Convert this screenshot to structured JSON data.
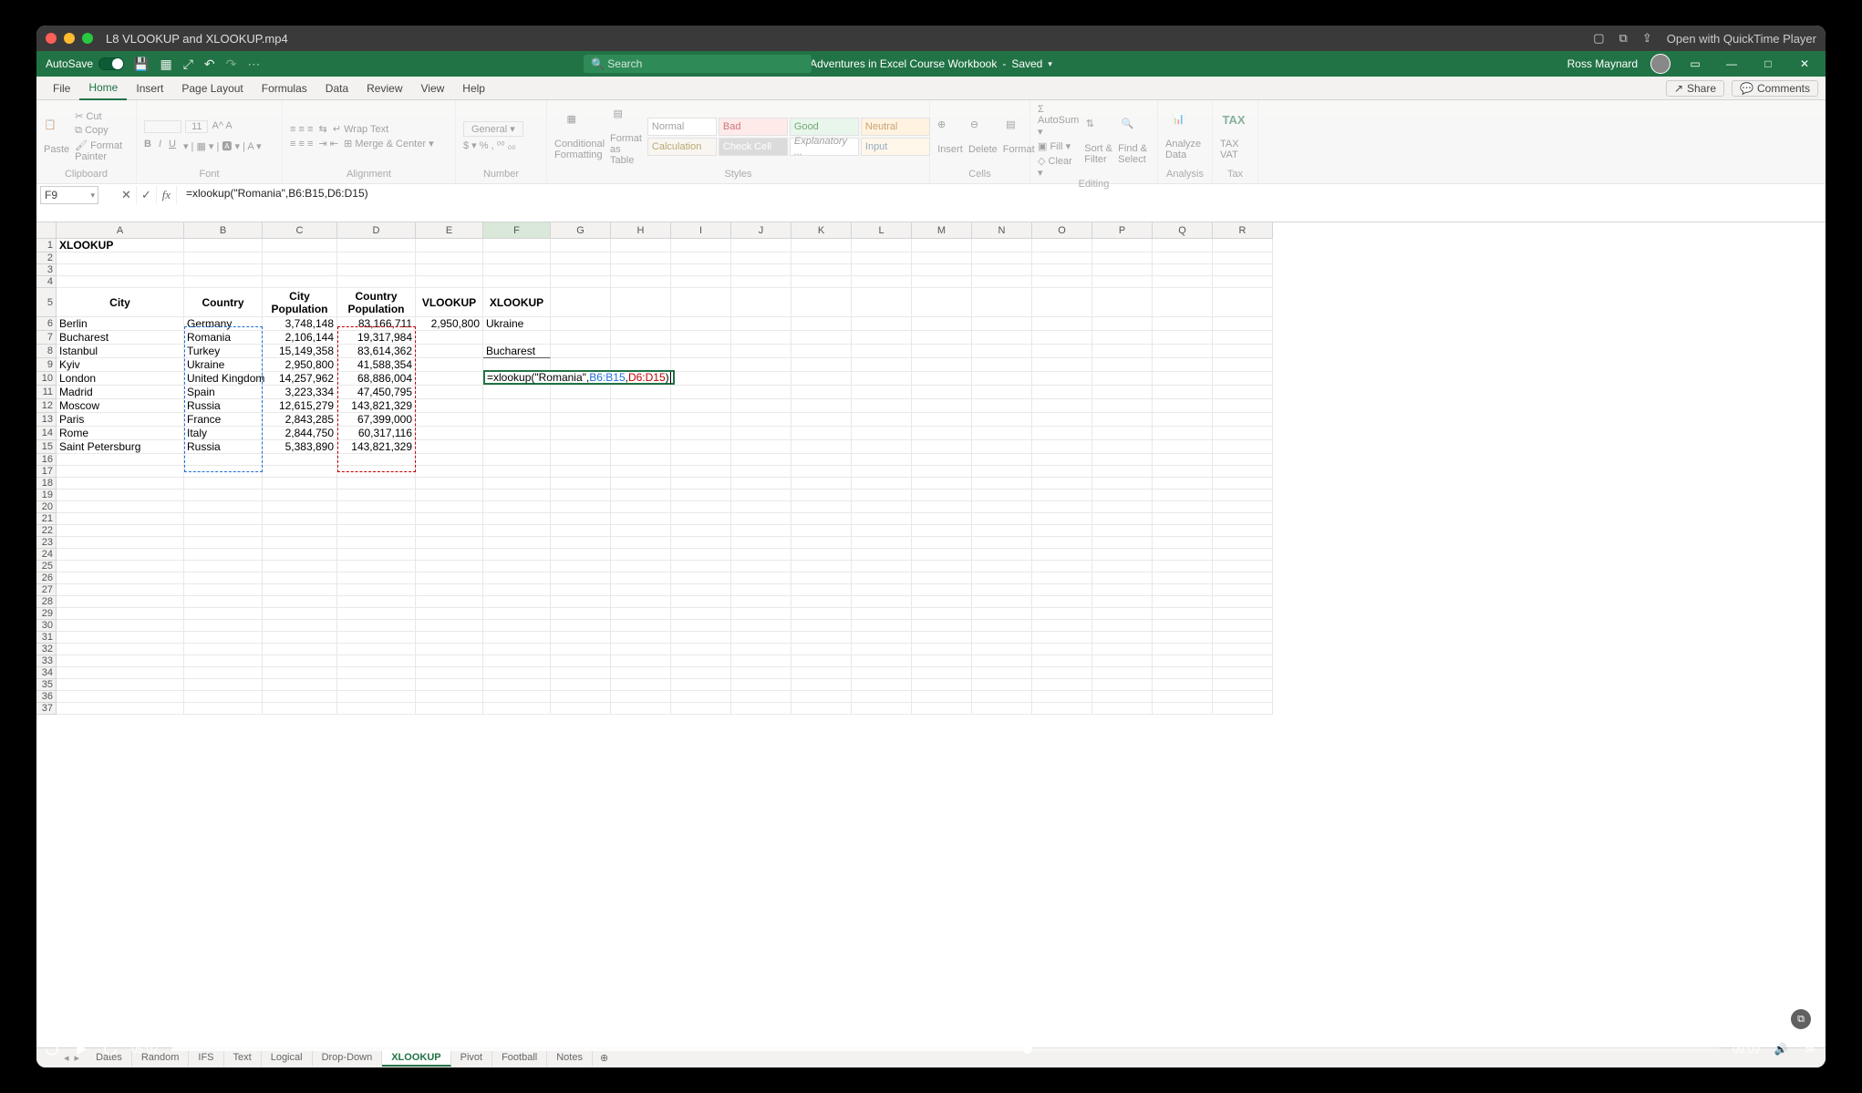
{
  "mac_titlebar": {
    "filename": "L8 VLOOKUP and XLOOKUP.mp4",
    "open_with": "Open with QuickTime Player"
  },
  "excel_titlebar": {
    "autosave_label": "AutoSave",
    "doc_title": "Adventures in Excel Course Workbook",
    "saved_label": "Saved",
    "search_placeholder": "Search",
    "user_name": "Ross Maynard"
  },
  "ribbon_tabs": [
    "File",
    "Home",
    "Insert",
    "Page Layout",
    "Formulas",
    "Data",
    "Review",
    "View",
    "Help"
  ],
  "ribbon_right": {
    "share": "Share",
    "comments": "Comments"
  },
  "ribbon_groups": {
    "clipboard": {
      "label": "Clipboard",
      "paste": "Paste",
      "cut": "Cut",
      "copy": "Copy",
      "format_painter": "Format Painter"
    },
    "font": {
      "label": "Font"
    },
    "alignment": {
      "label": "Alignment",
      "wrap": "Wrap Text",
      "merge": "Merge & Center"
    },
    "number": {
      "label": "Number",
      "general": "General"
    },
    "styles": {
      "label": "Styles",
      "cond": "Conditional Formatting",
      "fmt_table": "Format as Table",
      "normal": "Normal",
      "bad": "Bad",
      "good": "Good",
      "neutral": "Neutral",
      "calc": "Calculation",
      "check": "Check Cell",
      "expl": "Explanatory ...",
      "input": "Input"
    },
    "cells": {
      "label": "Cells",
      "insert": "Insert",
      "delete": "Delete",
      "format": "Format"
    },
    "editing": {
      "label": "Editing",
      "autosum": "AutoSum",
      "fill": "Fill",
      "clear": "Clear",
      "sort": "Sort & Filter",
      "find": "Find & Select"
    },
    "analysis": {
      "label": "Analysis",
      "analyze": "Analyze Data"
    },
    "tax": {
      "label": "Tax",
      "vat": "TAX VAT"
    }
  },
  "formula_bar": {
    "name_box": "F9",
    "formula": "=xlookup(\"Romania\",B6:B15,D6:D15)"
  },
  "columns": [
    "A",
    "B",
    "C",
    "D",
    "E",
    "F",
    "G",
    "H",
    "I",
    "J",
    "K",
    "L",
    "M",
    "N",
    "O",
    "P",
    "Q",
    "R"
  ],
  "row_count": 37,
  "sheet": {
    "title_cell": "XLOOKUP",
    "headers": {
      "city": "City",
      "country": "Country",
      "city_pop": "City Population",
      "country_pop": "Country Population",
      "vlookup": "VLOOKUP",
      "xlookup": "XLOOKUP"
    },
    "rows": [
      {
        "city": "Berlin",
        "country": "Germany",
        "city_pop": "3,748,148",
        "country_pop": "83,166,711"
      },
      {
        "city": "Bucharest",
        "country": "Romania",
        "city_pop": "2,106,144",
        "country_pop": "19,317,984"
      },
      {
        "city": "Istanbul",
        "country": "Turkey",
        "city_pop": "15,149,358",
        "country_pop": "83,614,362"
      },
      {
        "city": "Kyiv",
        "country": "Ukraine",
        "city_pop": "2,950,800",
        "country_pop": "41,588,354"
      },
      {
        "city": "London",
        "country": "United Kingdom",
        "city_pop": "14,257,962",
        "country_pop": "68,886,004"
      },
      {
        "city": "Madrid",
        "country": "Spain",
        "city_pop": "3,223,334",
        "country_pop": "47,450,795"
      },
      {
        "city": "Moscow",
        "country": "Russia",
        "city_pop": "12,615,279",
        "country_pop": "143,821,329"
      },
      {
        "city": "Paris",
        "country": "France",
        "city_pop": "2,843,285",
        "country_pop": "67,399,000"
      },
      {
        "city": "Rome",
        "country": "Italy",
        "city_pop": "2,844,750",
        "country_pop": "60,317,116"
      },
      {
        "city": "Saint Petersburg",
        "country": "Russia",
        "city_pop": "5,383,890",
        "country_pop": "143,821,329"
      }
    ],
    "e6": "2,950,800",
    "f6": "Ukraine",
    "f8": "Bucharest",
    "f9_edit": {
      "prefix": "=xlookup(\"Romania\",",
      "ref1": "B6:B15",
      "mid": ",",
      "ref2": "D6:D15",
      "suffix": ")"
    }
  },
  "sheet_tabs": [
    "Dates",
    "Random",
    "IFS",
    "Text",
    "Logical",
    "Drop-Down",
    "XLOOKUP",
    "Pivot",
    "Football",
    "Notes"
  ],
  "active_sheet_tab": "XLOOKUP",
  "video": {
    "current": "05:02",
    "duration": "09:09",
    "progress_pct": 55.3
  }
}
